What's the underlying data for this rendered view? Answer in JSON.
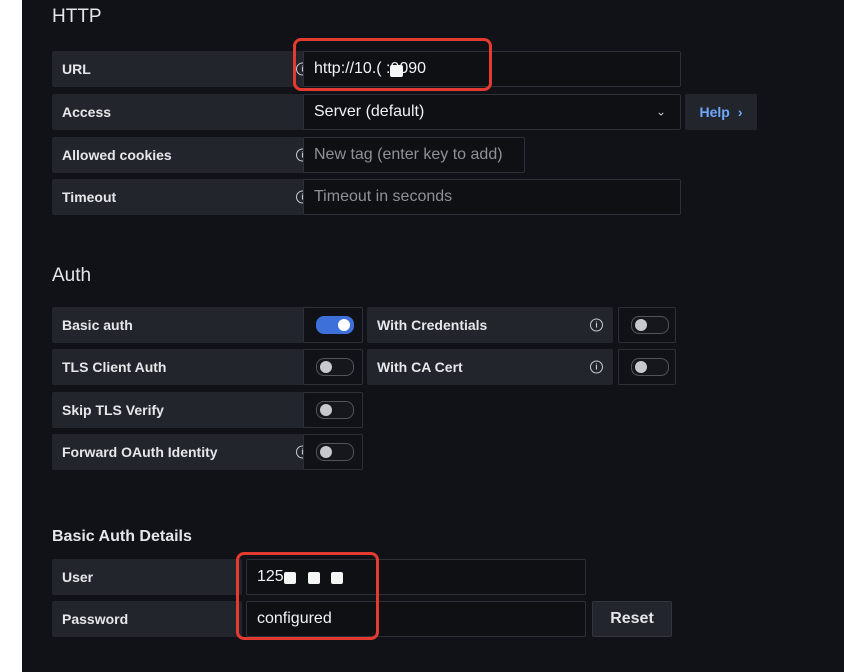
{
  "http": {
    "title": "HTTP",
    "url": {
      "label": "URL",
      "value": "http://10.(   :9090"
    },
    "access": {
      "label": "Access",
      "value": "Server (default)",
      "help_label": "Help"
    },
    "allowed_cookies": {
      "label": "Allowed cookies",
      "placeholder": "New tag (enter key to add)"
    },
    "timeout": {
      "label": "Timeout",
      "placeholder": "Timeout in seconds"
    }
  },
  "auth": {
    "title": "Auth",
    "basic_auth": {
      "label": "Basic auth",
      "enabled": true
    },
    "with_credentials": {
      "label": "With Credentials",
      "enabled": false
    },
    "tls_client_auth": {
      "label": "TLS Client Auth",
      "enabled": false
    },
    "with_ca_cert": {
      "label": "With CA Cert",
      "enabled": false
    },
    "skip_tls_verify": {
      "label": "Skip TLS Verify",
      "enabled": false
    },
    "forward_oauth": {
      "label": "Forward OAuth Identity",
      "enabled": false
    }
  },
  "basic_auth_details": {
    "title": "Basic Auth Details",
    "user": {
      "label": "User",
      "value": "125"
    },
    "password": {
      "label": "Password",
      "value": "configured",
      "reset_label": "Reset"
    }
  },
  "colors": {
    "panel_bg": "#111217",
    "label_bg": "#22252b",
    "input_border": "#2d3038",
    "toggle_on": "#3d71d9",
    "help_link": "#6ea8ff",
    "annotation_red": "#e33b2f"
  },
  "icons": {
    "info": "info-circle-icon",
    "dropdown": "chevron-down-icon",
    "help_chevron": "chevron-right-icon"
  }
}
